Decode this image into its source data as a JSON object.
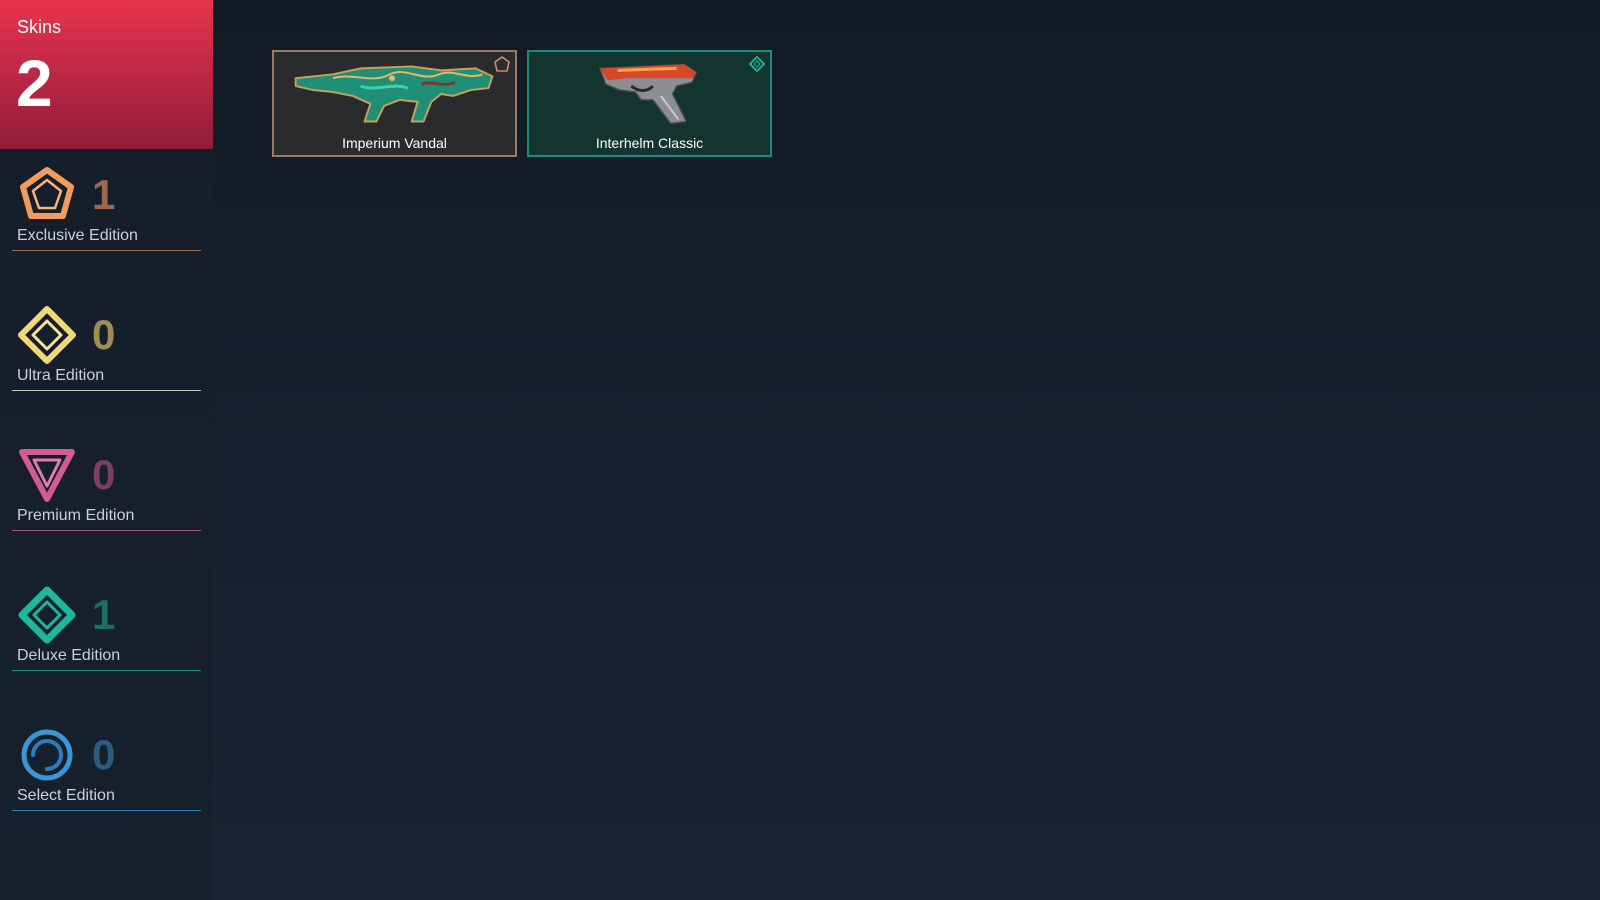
{
  "header": {
    "label": "Skins",
    "count": "2",
    "gradient_top": "#e8344e",
    "gradient_bottom": "#8e1c38"
  },
  "tiers": [
    {
      "name": "Exclusive Edition",
      "count": "1",
      "icon": "exclusive-edition-icon",
      "color": "#f39a5c",
      "count_color": "#9a6a4f"
    },
    {
      "name": "Ultra Edition",
      "count": "0",
      "icon": "ultra-edition-icon",
      "color": "#f3d67b",
      "count_color": "#a08c55"
    },
    {
      "name": "Premium Edition",
      "count": "0",
      "icon": "premium-edition-icon",
      "color": "#d35b95",
      "count_color": "#7d3f5e"
    },
    {
      "name": "Deluxe Edition",
      "count": "1",
      "icon": "deluxe-edition-icon",
      "color": "#1bb89c",
      "count_color": "#1c6d63"
    },
    {
      "name": "Select Edition",
      "count": "0",
      "icon": "select-edition-icon",
      "color": "#3a97d6",
      "count_color": "#2b5c7f"
    }
  ],
  "skins": [
    {
      "name": "Imperium Vandal",
      "tier": "Exclusive Edition",
      "border_color": "#9c7a63",
      "background": "#2a2b2d"
    },
    {
      "name": "Interhelm Classic",
      "tier": "Deluxe Edition",
      "border_color": "#1d8c7b",
      "background": "#14342f"
    }
  ]
}
